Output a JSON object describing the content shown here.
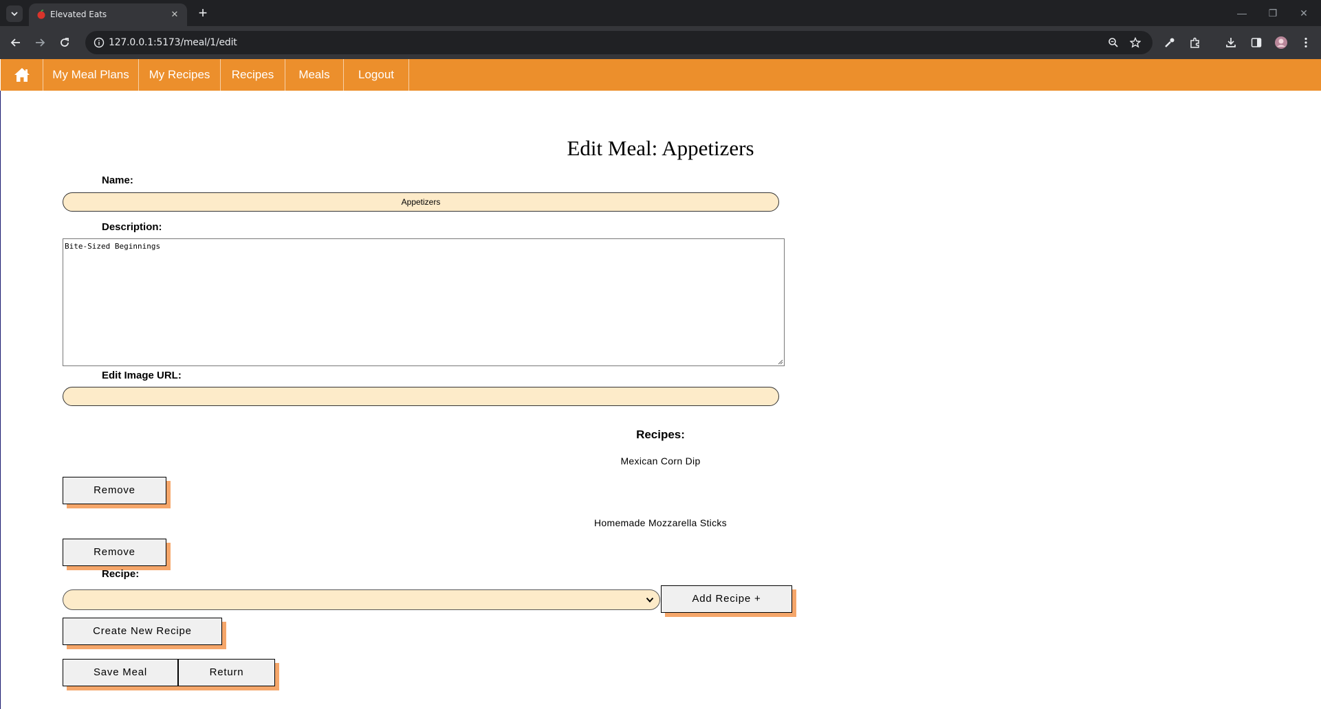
{
  "browser": {
    "tab_title": "Elevated Eats",
    "url": "127.0.0.1:5173/meal/1/edit"
  },
  "navbar": {
    "items": [
      "My Meal Plans",
      "My Recipes",
      "Recipes",
      "Meals",
      "Logout"
    ],
    "color": "#ec8f2c"
  },
  "page": {
    "title": "Edit Meal: Appetizers",
    "name_label": "Name:",
    "name_value": "Appetizers",
    "description_label": "Description:",
    "description_value": "Bite-Sized Beginnings",
    "image_label": "Edit Image URL:",
    "image_value": "",
    "recipes_heading": "Recipes:",
    "recipes": [
      {
        "name": "Mexican Corn Dip",
        "remove_label": "Remove"
      },
      {
        "name": "Homemade Mozzarella Sticks",
        "remove_label": "Remove"
      }
    ],
    "recipe_label": "Recipe:",
    "recipe_select_value": "",
    "add_recipe_label": "Add Recipe +",
    "create_recipe_label": "Create New Recipe",
    "save_label": "Save Meal",
    "return_label": "Return"
  },
  "colors": {
    "input_bg": "#fdebc9",
    "button_shadow": "#f5a66a"
  }
}
